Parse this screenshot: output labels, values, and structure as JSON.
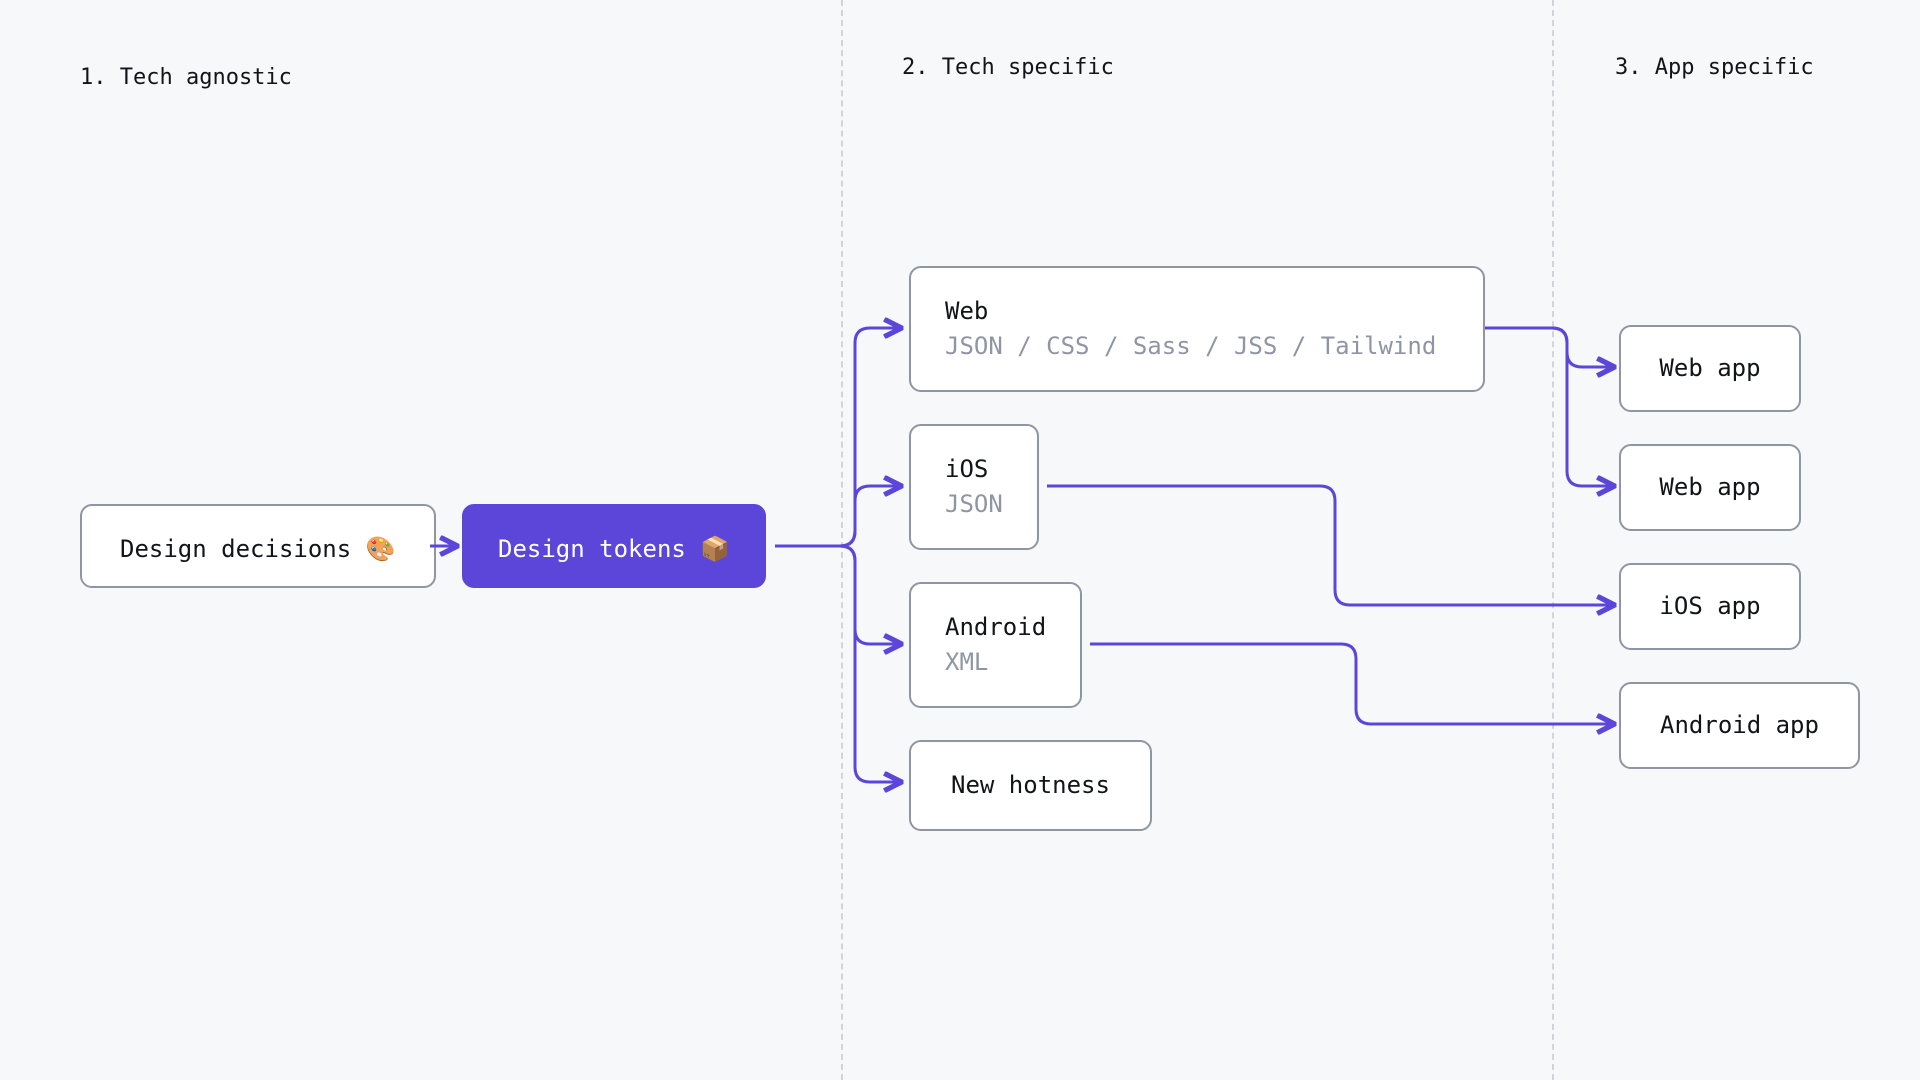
{
  "sections": {
    "s1": "1. Tech agnostic",
    "s2": "2. Tech specific",
    "s3": "3. App specific"
  },
  "agnostic": {
    "decisions": "Design decisions 🎨",
    "tokens": "Design tokens 📦"
  },
  "tech": {
    "web": {
      "title": "Web",
      "sub": "JSON / CSS / Sass / JSS / Tailwind"
    },
    "ios": {
      "title": "iOS",
      "sub": "JSON"
    },
    "android": {
      "title": "Android",
      "sub": "XML"
    },
    "new": {
      "title": "New hotness"
    }
  },
  "apps": {
    "web1": "Web app",
    "web2": "Web app",
    "ios": "iOS app",
    "android": "Android app"
  }
}
